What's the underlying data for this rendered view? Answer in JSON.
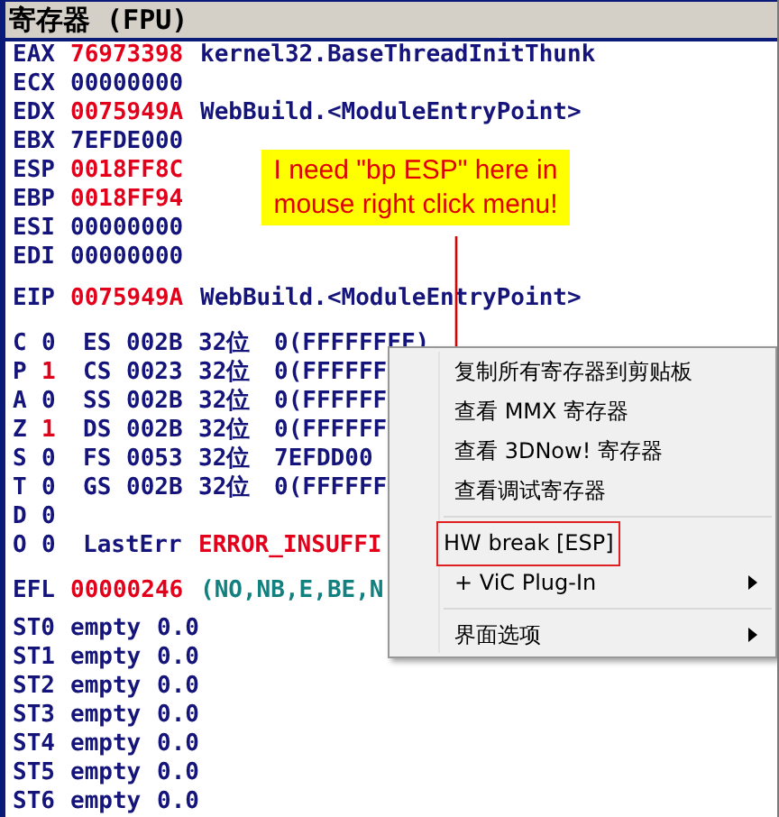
{
  "panel": {
    "title": "寄存器 (FPU)"
  },
  "registers": [
    {
      "name": "EAX",
      "value": "76973398",
      "changed": true,
      "comment": "kernel32.BaseThreadInitThunk"
    },
    {
      "name": "ECX",
      "value": "00000000",
      "changed": false
    },
    {
      "name": "EDX",
      "value": "0075949A",
      "changed": true,
      "comment": "WebBuild.<ModuleEntryPoint>"
    },
    {
      "name": "EBX",
      "value": "7EFDE000",
      "changed": false
    },
    {
      "name": "ESP",
      "value": "0018FF8C",
      "changed": true
    },
    {
      "name": "EBP",
      "value": "0018FF94",
      "changed": true
    },
    {
      "name": "ESI",
      "value": "00000000",
      "changed": false
    },
    {
      "name": "EDI",
      "value": "00000000",
      "changed": false
    }
  ],
  "eip": {
    "name": "EIP",
    "value": "0075949A",
    "changed": true,
    "comment": "WebBuild.<ModuleEntryPoint>"
  },
  "flags": [
    {
      "kind": "segment",
      "name": "C",
      "value": "0",
      "changed": false,
      "segment": "ES",
      "selector": "002B",
      "bits": "32位",
      "base": "0(FFFFFFFF)"
    },
    {
      "kind": "segment",
      "name": "P",
      "value": "1",
      "changed": true,
      "segment": "CS",
      "selector": "0023",
      "bits": "32位",
      "base": "0(FFFFFF"
    },
    {
      "kind": "segment",
      "name": "A",
      "value": "0",
      "changed": false,
      "segment": "SS",
      "selector": "002B",
      "bits": "32位",
      "base": "0(FFFFFF"
    },
    {
      "kind": "segment",
      "name": "Z",
      "value": "1",
      "changed": true,
      "segment": "DS",
      "selector": "002B",
      "bits": "32位",
      "base": "0(FFFFFF"
    },
    {
      "kind": "segment",
      "name": "S",
      "value": "0",
      "changed": false,
      "segment": "FS",
      "selector": "0053",
      "bits": "32位",
      "base": "7EFDD00"
    },
    {
      "kind": "segment",
      "name": "T",
      "value": "0",
      "changed": false,
      "segment": "GS",
      "selector": "002B",
      "bits": "32位",
      "base": "0(FFFFFF"
    },
    {
      "kind": "plain",
      "name": "D",
      "value": "0",
      "changed": false
    },
    {
      "kind": "lasterr",
      "name": "O",
      "value": "0",
      "changed": false,
      "key": "LastErr",
      "error": "ERROR_INSUFFI"
    }
  ],
  "efl": {
    "name": "EFL",
    "value": "00000246",
    "changed": true,
    "conditions": "(NO,NB,E,BE,N"
  },
  "fpu": [
    {
      "name": "ST0",
      "tag": "empty",
      "value": "0.0"
    },
    {
      "name": "ST1",
      "tag": "empty",
      "value": "0.0"
    },
    {
      "name": "ST2",
      "tag": "empty",
      "value": "0.0"
    },
    {
      "name": "ST3",
      "tag": "empty",
      "value": "0.0"
    },
    {
      "name": "ST4",
      "tag": "empty",
      "value": "0.0"
    },
    {
      "name": "ST5",
      "tag": "empty",
      "value": "0.0"
    },
    {
      "name": "ST6",
      "tag": "empty",
      "value": "0.0"
    }
  ],
  "annotation": {
    "text": "I need \"bp ESP\" here in mouse right click menu!"
  },
  "context_menu": {
    "items": [
      {
        "kind": "item",
        "label": "复制所有寄存器到剪贴板",
        "submenu": false,
        "boxed": false
      },
      {
        "kind": "item",
        "label": "查看 MMX 寄存器",
        "submenu": false,
        "boxed": false
      },
      {
        "kind": "item",
        "label": "查看 3DNow! 寄存器",
        "submenu": false,
        "boxed": false
      },
      {
        "kind": "item",
        "label": "查看调试寄存器",
        "submenu": false,
        "boxed": false
      },
      {
        "kind": "separator"
      },
      {
        "kind": "item",
        "label": "HW break [ESP]",
        "submenu": false,
        "boxed": true
      },
      {
        "kind": "item",
        "label": "+ ViC Plug-In",
        "submenu": true,
        "boxed": false
      },
      {
        "kind": "separator"
      },
      {
        "kind": "item",
        "label": "界面选项",
        "submenu": true,
        "boxed": false
      }
    ]
  }
}
